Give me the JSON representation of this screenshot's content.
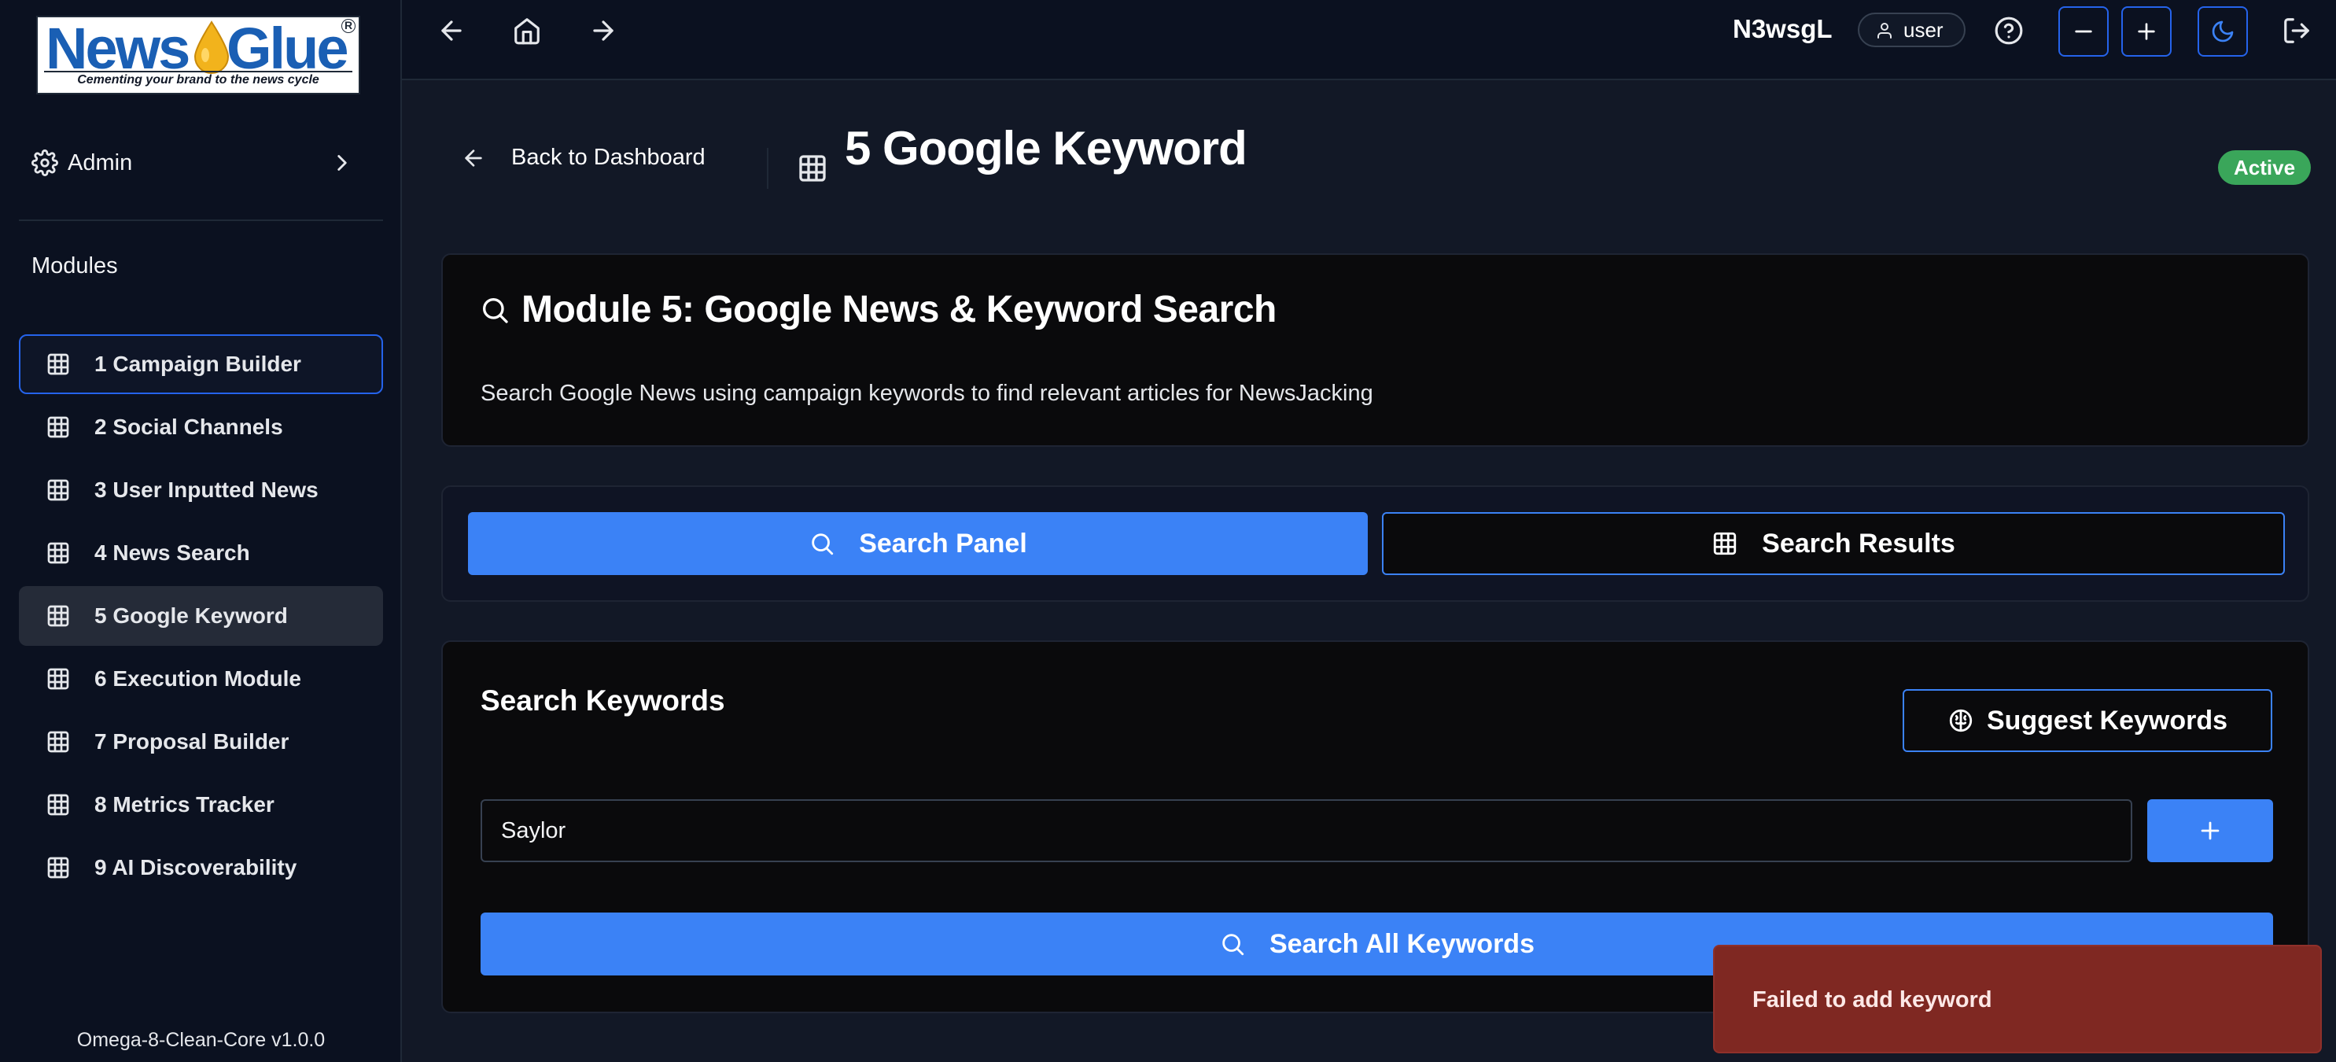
{
  "sidebar": {
    "logo": {
      "word1": "News",
      "word2": "Glue",
      "registered": "R",
      "tagline": "Cementing your brand to the news cycle"
    },
    "admin_label": "Admin",
    "modules_heading": "Modules",
    "items": [
      {
        "label": "1 Campaign Builder",
        "icon": "grid-icon",
        "state": "focused"
      },
      {
        "label": "2 Social Channels",
        "icon": "grid-icon"
      },
      {
        "label": "3 User Inputted News",
        "icon": "grid-icon"
      },
      {
        "label": "4 News Search",
        "icon": "grid-icon"
      },
      {
        "label": "5 Google Keyword",
        "icon": "grid-icon",
        "state": "selected"
      },
      {
        "label": "6 Execution Module",
        "icon": "grid-icon"
      },
      {
        "label": "7 Proposal Builder",
        "icon": "grid-icon"
      },
      {
        "label": "8 Metrics Tracker",
        "icon": "grid-icon"
      },
      {
        "label": "9 AI Discoverability",
        "icon": "grid-icon"
      }
    ],
    "version": "Omega-8-Clean-Core v1.0.0"
  },
  "topbar": {
    "username": "N3wsgL",
    "role": "user",
    "icons": [
      "back-arrow-icon",
      "home-icon",
      "forward-arrow-icon",
      "help-icon",
      "zoom-out-icon",
      "zoom-in-icon",
      "moon-icon",
      "logout-icon"
    ]
  },
  "header": {
    "back_label": "Back to Dashboard",
    "title": "5 Google Keyword",
    "status": "Active"
  },
  "module_card": {
    "title": "Module 5: Google News & Keyword Search",
    "description": "Search Google News using campaign keywords to find relevant articles for NewsJacking"
  },
  "tabs": [
    {
      "label": "Search Panel",
      "active": true
    },
    {
      "label": "Search Results",
      "active": false
    }
  ],
  "keywords": {
    "heading": "Search Keywords",
    "suggest_label": "Suggest Keywords",
    "input_value": "Saylor",
    "search_all_label": "Search All Keywords"
  },
  "toast": {
    "message": "Failed to add keyword"
  },
  "colors": {
    "accent": "#3b82f6",
    "status_active": "#3aa65a",
    "toast_error": "#7f2822",
    "background": "#121826",
    "sidebar": "#0b1120"
  }
}
